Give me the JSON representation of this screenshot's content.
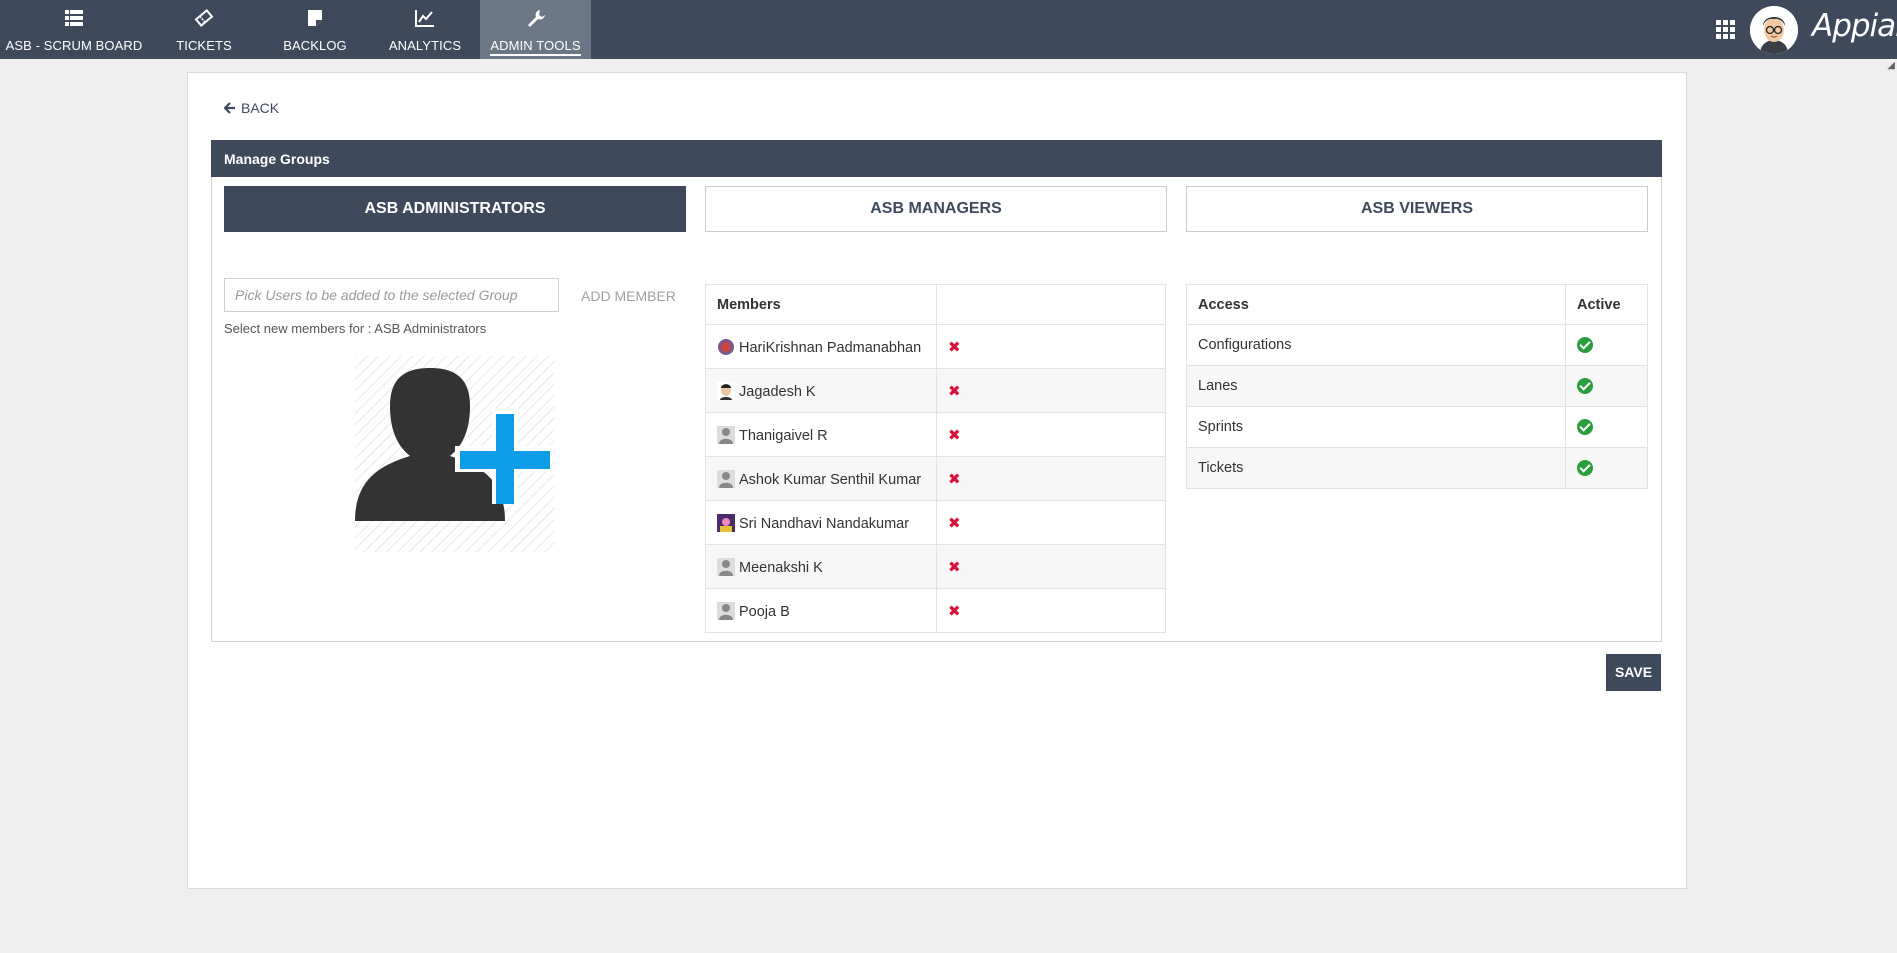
{
  "nav": {
    "tabs": [
      {
        "label": "ASB - SCRUM BOARD",
        "icon": "list-icon"
      },
      {
        "label": "TICKETS",
        "icon": "ticket-icon"
      },
      {
        "label": "BACKLOG",
        "icon": "sticky-note-icon"
      },
      {
        "label": "ANALYTICS",
        "icon": "line-chart-icon"
      },
      {
        "label": "ADMIN TOOLS",
        "icon": "wrench-icon",
        "active": true
      }
    ],
    "brand": "Appian"
  },
  "back_label": "BACK",
  "panel_title": "Manage Groups",
  "groups": [
    {
      "label": "ASB ADMINISTRATORS",
      "selected": true
    },
    {
      "label": "ASB MANAGERS"
    },
    {
      "label": "ASB VIEWERS"
    }
  ],
  "picker": {
    "placeholder": "Pick Users to be added to the selected Group",
    "add_label": "ADD MEMBER",
    "help": "Select new members for : ASB Administrators"
  },
  "members_table": {
    "header": "Members",
    "rows": [
      "HariKrishnan Padmanabhan",
      "Jagadesh K",
      "Thanigaivel R",
      "Ashok Kumar Senthil Kumar",
      "Sri Nandhavi Nandakumar",
      "Meenakshi K",
      "Pooja B"
    ],
    "remove_icon": "remove-x-icon"
  },
  "access_table": {
    "headers": [
      "Access",
      "Active"
    ],
    "rows": [
      "Configurations",
      "Lanes",
      "Sprints",
      "Tickets"
    ],
    "active_icon": "check-circle-icon"
  },
  "save_label": "SAVE",
  "colors": {
    "nav": "#3e4a5c",
    "remove": "#d8133a",
    "active": "#2a9d3f",
    "add_blue": "#0e9de6"
  }
}
